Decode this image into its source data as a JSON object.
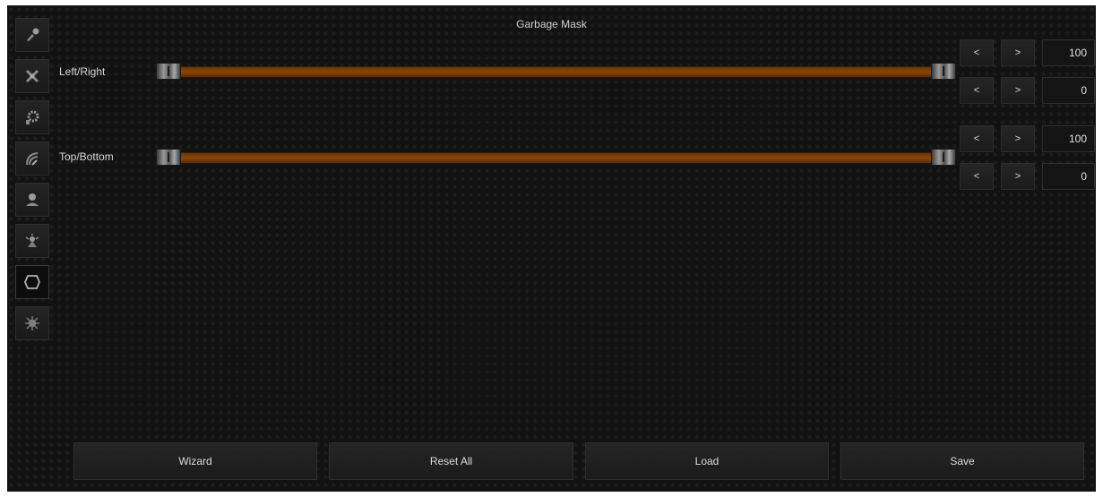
{
  "panel": {
    "title": "Garbage Mask"
  },
  "sidebar": {
    "items": [
      {
        "icon": "brush-icon"
      },
      {
        "icon": "cross-tools-icon"
      },
      {
        "icon": "gear-icon"
      },
      {
        "icon": "signal-icon"
      },
      {
        "icon": "person-icon"
      },
      {
        "icon": "spotlight-icon"
      },
      {
        "icon": "mask-outline-icon",
        "active": true
      },
      {
        "icon": "settings-burst-icon"
      }
    ]
  },
  "rows": [
    {
      "label": "Left/Right",
      "range": {
        "min_value": 0,
        "max_value": 100
      },
      "max_spinner": {
        "dec_label": "<",
        "inc_label": ">",
        "value": "100"
      },
      "min_spinner": {
        "dec_label": "<",
        "inc_label": ">",
        "value": "0"
      }
    },
    {
      "label": "Top/Bottom",
      "range": {
        "min_value": 0,
        "max_value": 100
      },
      "max_spinner": {
        "dec_label": "<",
        "inc_label": ">",
        "value": "100"
      },
      "min_spinner": {
        "dec_label": "<",
        "inc_label": ">",
        "value": "0"
      }
    }
  ],
  "footer": {
    "wizard_label": "Wizard",
    "reset_label": "Reset All",
    "load_label": "Load",
    "save_label": "Save"
  },
  "colors": {
    "background": "#121212",
    "track": "#8a4608",
    "text": "#d0d0d0"
  }
}
